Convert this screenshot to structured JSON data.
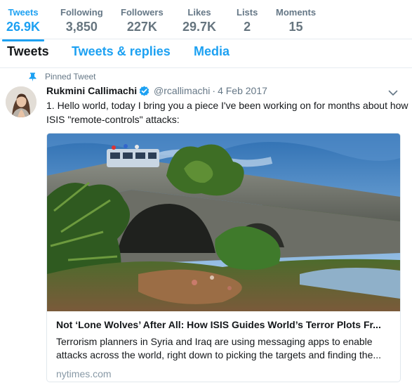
{
  "stats": [
    {
      "label": "Tweets",
      "value": "26.9K",
      "active": true
    },
    {
      "label": "Following",
      "value": "3,850"
    },
    {
      "label": "Followers",
      "value": "227K"
    },
    {
      "label": "Likes",
      "value": "29.7K"
    },
    {
      "label": "Lists",
      "value": "2"
    },
    {
      "label": "Moments",
      "value": "15"
    }
  ],
  "tabs": {
    "tweets": "Tweets",
    "replies": "Tweets & replies",
    "media": "Media"
  },
  "tweet": {
    "pinned_label": "Pinned Tweet",
    "fullname": "Rukmini Callimachi",
    "username": "@rcallimachi",
    "separator": "·",
    "date": "4 Feb 2017",
    "text": "1. Hello world, today I bring you a piece I've been working on for months about how ISIS \"remote-controls\" attacks:",
    "card": {
      "title": "Not ‘Lone Wolves’ After All: How ISIS Guides World’s Terror Plots Fr...",
      "description": "Terrorism planners in Syria and Iraq are using messaging apps to enable attacks across the world, right down to picking the targets and finding the...",
      "domain": "nytimes.com"
    }
  },
  "colors": {
    "accent": "#1da1f2",
    "text": "#14171a",
    "muted": "#657786",
    "border": "#e6ecf0"
  },
  "icons": {
    "pin": "pin-icon",
    "verified": "verified-badge-icon",
    "caret": "chevron-down-icon"
  }
}
